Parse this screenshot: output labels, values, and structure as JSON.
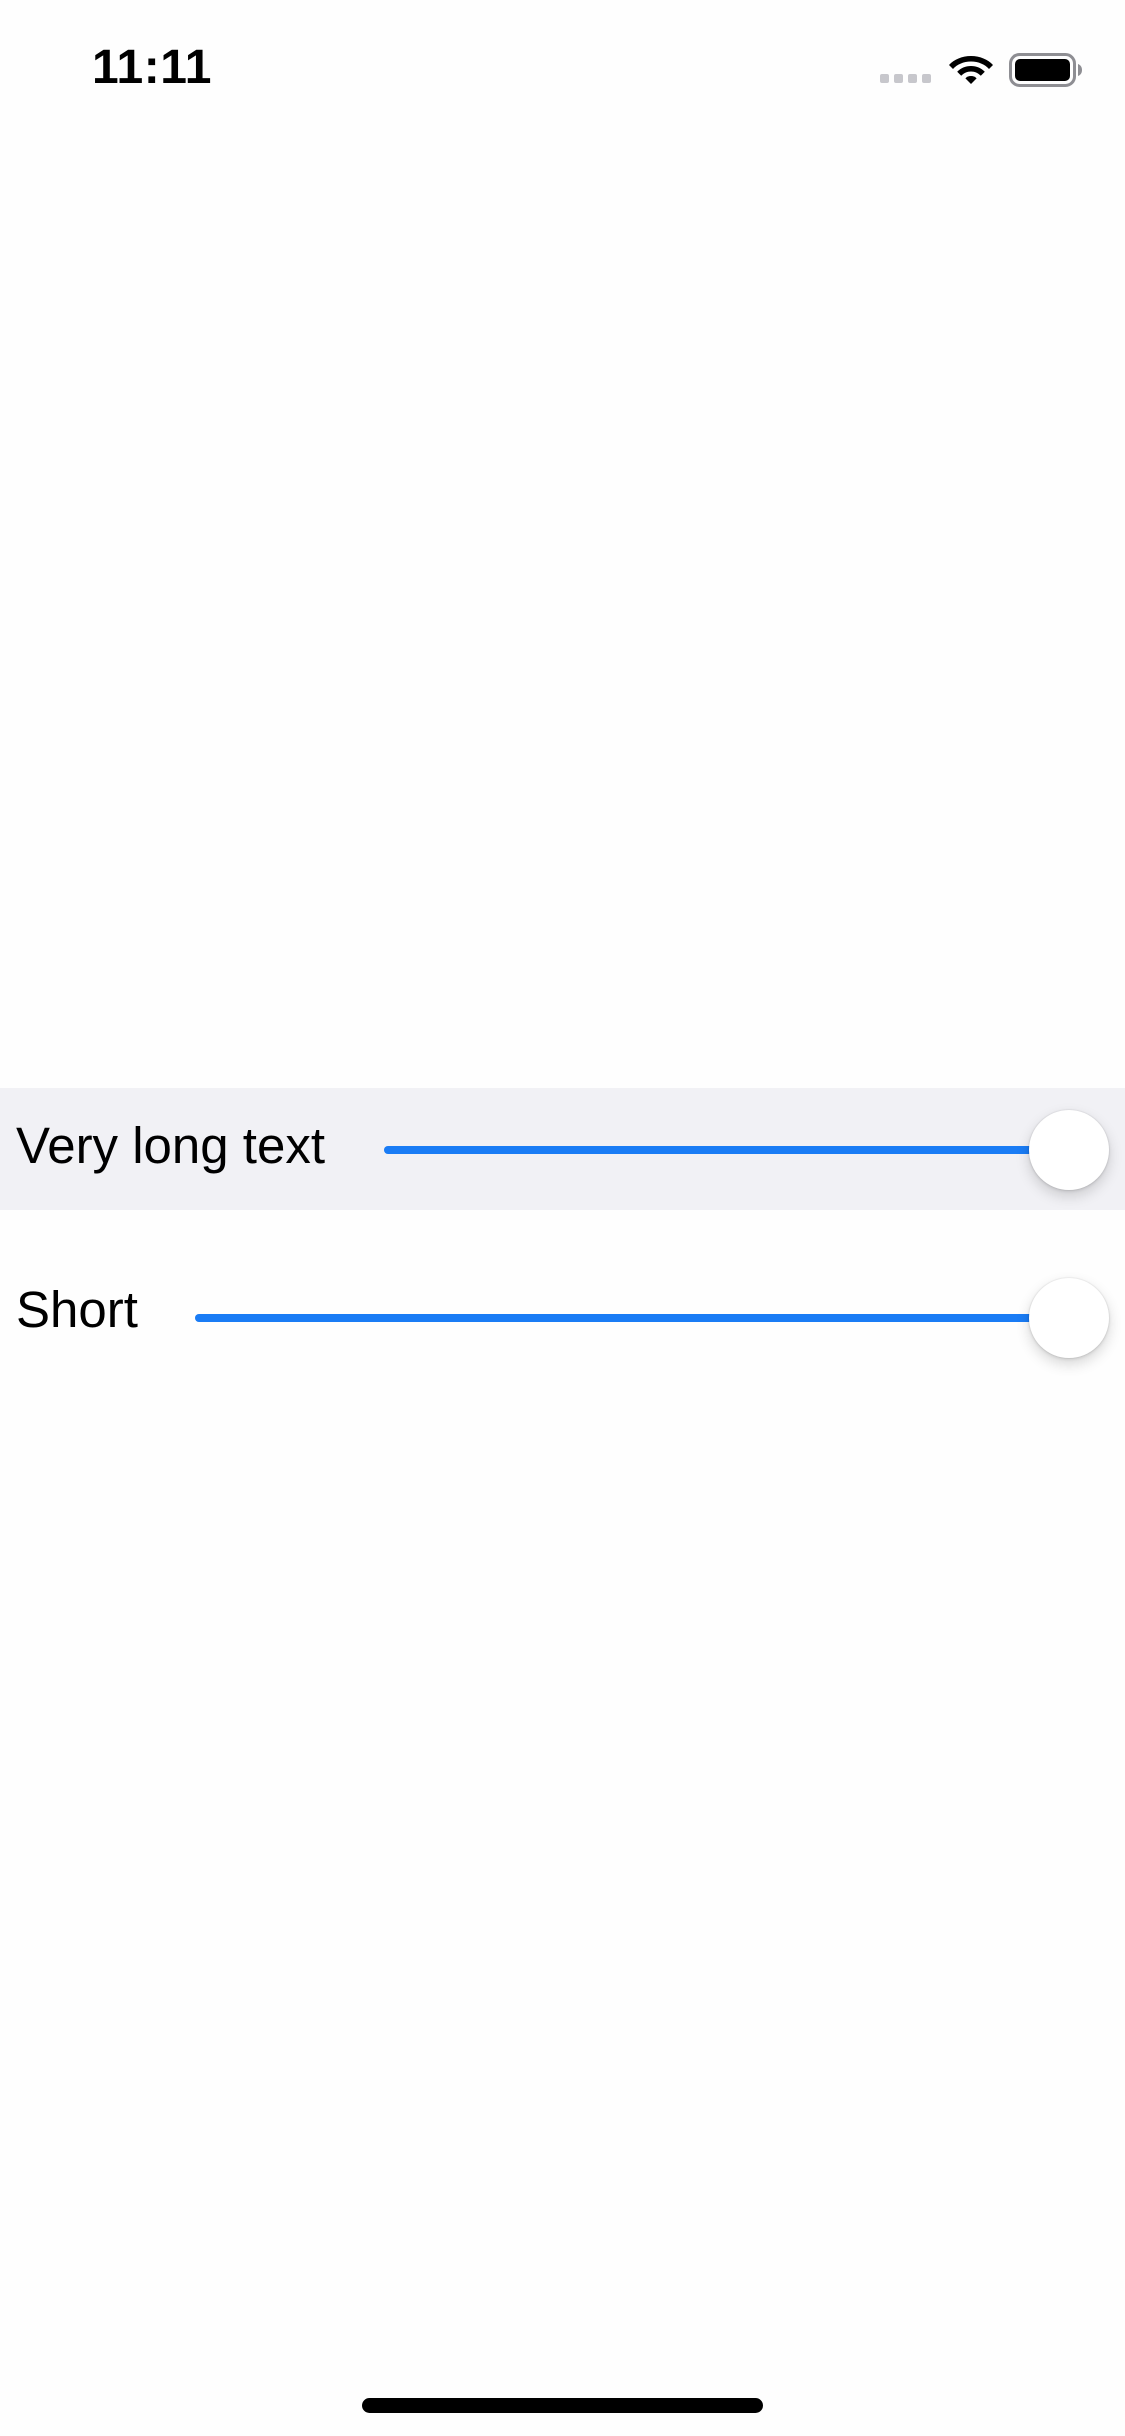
{
  "status_bar": {
    "time": "11:11",
    "icons": [
      "cellular-signal-icon",
      "wifi-icon",
      "battery-icon"
    ]
  },
  "sliders": [
    {
      "label": "Very long text",
      "value": 1.0,
      "highlighted": true
    },
    {
      "label": "Short",
      "value": 1.0,
      "highlighted": false
    }
  ],
  "colors": {
    "accent": "#1a7cf5",
    "row_highlight": "#f1f1f5",
    "background": "#fefefe"
  }
}
